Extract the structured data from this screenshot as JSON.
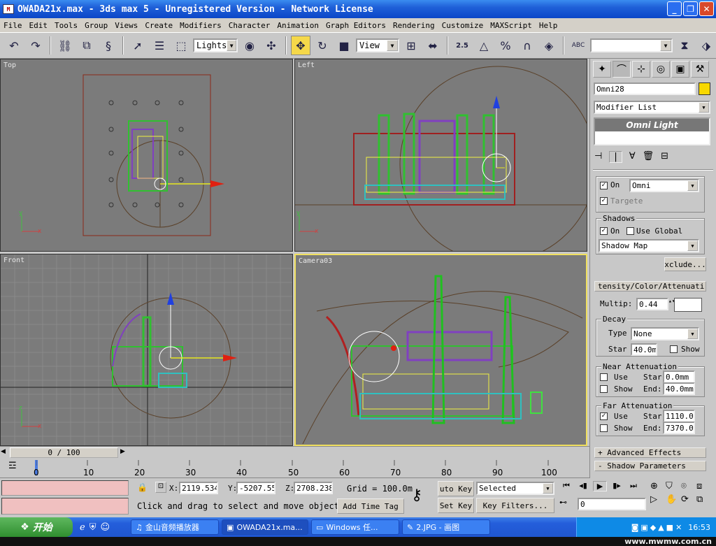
{
  "window": {
    "title": "OWADA21x.max - 3ds max 5 - Unregistered Version - Network License",
    "app_icon": "max-icon"
  },
  "menu": [
    "File",
    "Edit",
    "Tools",
    "Group",
    "Views",
    "Create",
    "Modifiers",
    "Character",
    "Animation",
    "Graph Editors",
    "Rendering",
    "Customize",
    "MAXScript",
    "Help"
  ],
  "toolbar": {
    "selection_filter": "Lights",
    "ref_coord": "View",
    "snap_value": "2.5"
  },
  "viewports": {
    "top": "Top",
    "left": "Left",
    "front": "Front",
    "camera": "Camera03"
  },
  "watermark": "MWMW.CN",
  "panel": {
    "object_name": "Omni28",
    "object_color": "#f8d800",
    "modifier_list": "Modifier List",
    "stack_item": "Omni Light",
    "light_on": "On",
    "light_type": "Omni",
    "targeted": "Targete",
    "shadows_title": "Shadows",
    "shadows_on": "On",
    "use_global": "Use Global",
    "shadow_type": "Shadow Map",
    "exclude": "xclude...",
    "intensity_rollout": "tensity/Color/Attenuati",
    "multiplier_label": "Multip:",
    "multiplier": "0.44",
    "decay_title": "Decay",
    "decay_type_label": "Type",
    "decay_type": "None",
    "decay_start_label": "Star",
    "decay_start": "40.0m",
    "decay_show": "Show",
    "near_title": "Near Attenuation",
    "near_use": "Use",
    "near_show": "Show",
    "near_start_label": "Star",
    "near_start": "0.0mm",
    "near_end_label": "End:",
    "near_end": "40.0mm",
    "far_title": "Far Attenuation",
    "far_use": "Use",
    "far_show": "Show",
    "far_start_label": "Star",
    "far_start": "1110.0",
    "far_end_label": "End:",
    "far_end": "7370.0",
    "advanced_effects": "+ Advanced Effects",
    "shadow_params": "- Shadow Parameters"
  },
  "timeline": {
    "slider": "0 / 100",
    "ticks": [
      "0",
      "10",
      "20",
      "30",
      "40",
      "50",
      "60",
      "70",
      "80",
      "90",
      "100"
    ]
  },
  "status": {
    "x_label": "X:",
    "x": "2119.534",
    "y_label": "Y:",
    "y": "-5207.55",
    "z_label": "Z:",
    "z": "2708.238",
    "grid": "Grid = 100.0m",
    "prompt": "Click and drag to select and move objects",
    "add_time_tag": "Add Time Tag",
    "auto_key": "uto Key",
    "selected": "Selected",
    "set_key": "Set Key",
    "key_filters": "Key Filters...",
    "frame": "0"
  },
  "taskbar": {
    "start": "开始",
    "tasks": [
      "金山音频播放器",
      "OWADA21x.ma...",
      "Windows 任...",
      "2.JPG - 画图"
    ],
    "clock": "16:53"
  },
  "site": "www.mwmw.com.cn"
}
